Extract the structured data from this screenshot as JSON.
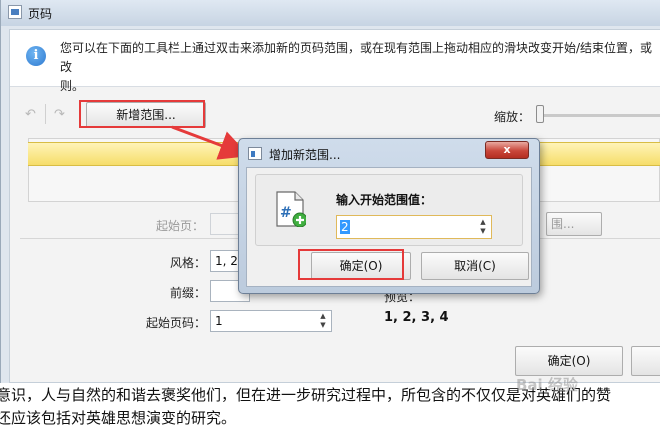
{
  "window": {
    "title": "页码"
  },
  "info": {
    "text": "您可以在下面的工具栏上通过双击来添加新的页码范围，或在现有范围上拖动相应的滑块改变开始/结束位置，或改\n则。"
  },
  "toolbar": {
    "add_range_label": "新增范围...",
    "zoom_label": "缩放：",
    "undo_icon": "undo-arrow-icon",
    "redo_icon": "redo-arrow-icon"
  },
  "form": {
    "start_page_label": "起始页：",
    "style_label": "风格：",
    "style_value": "1, 2,",
    "prefix_label": "前缀：",
    "start_number_label": "起始页码：",
    "start_number_value": "1",
    "preview_label": "预览：",
    "preview_value": "1, 2, 3, 4",
    "range_btn_partial": "围..."
  },
  "main_buttons": {
    "ok_label": "确定(O)"
  },
  "dialog": {
    "title": "增加新范围...",
    "close_label": "x",
    "prompt": "输入开始范围值：",
    "value": "2",
    "ok_label": "确定(O)",
    "cancel_label": "取消(C)"
  },
  "caption": {
    "line1": "意识，人与自然的和谐去褒奖他们，但在进一步研究过程中，所包含的不仅仅是对英雄们的赞",
    "line2": "还应该包括对英雄思想演变的研究。"
  },
  "watermark": "Bai 经验",
  "colors": {
    "highlight_red": "#e53a3a",
    "range_yellow": "#f6dd6a",
    "selection_blue": "#3399ff"
  }
}
